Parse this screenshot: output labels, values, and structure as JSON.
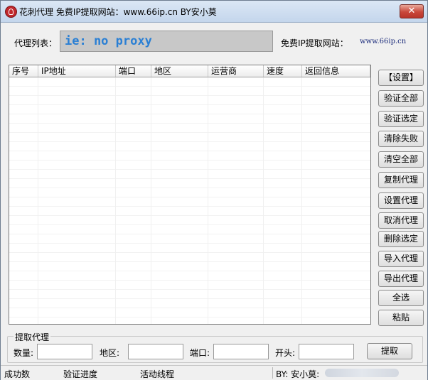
{
  "window": {
    "title": "花刺代理 免费IP提取网站：www.66ip.cn   BY安小莫",
    "close_glyph": "✕"
  },
  "top": {
    "proxy_list_label": "代理列表：",
    "proxy_value": "ie: no proxy",
    "free_site_label": "免费IP提取网站：",
    "site_url": "www.66ip.cn"
  },
  "table": {
    "headers": [
      "序号",
      "IP地址",
      "端口",
      "地区",
      "运营商",
      "速度",
      "返回信息"
    ],
    "rows": []
  },
  "side_buttons": [
    "【设置】",
    "验证全部",
    "验证选定",
    "清除失败",
    "清空全部",
    "复制代理",
    "设置代理",
    "取消代理",
    "删除选定",
    "导入代理",
    "导出代理",
    "全选",
    "粘贴"
  ],
  "extract": {
    "group_title": "提取代理",
    "count_label": "数量:",
    "region_label": "地区:",
    "port_label": "端口:",
    "prefix_label": "开头:",
    "count_value": "",
    "region_value": "",
    "port_value": "",
    "prefix_value": "",
    "fetch_button": "提取"
  },
  "status": {
    "success": "成功数",
    "progress": "验证进度",
    "threads": "活动线程",
    "author": "BY: 安小莫:"
  }
}
